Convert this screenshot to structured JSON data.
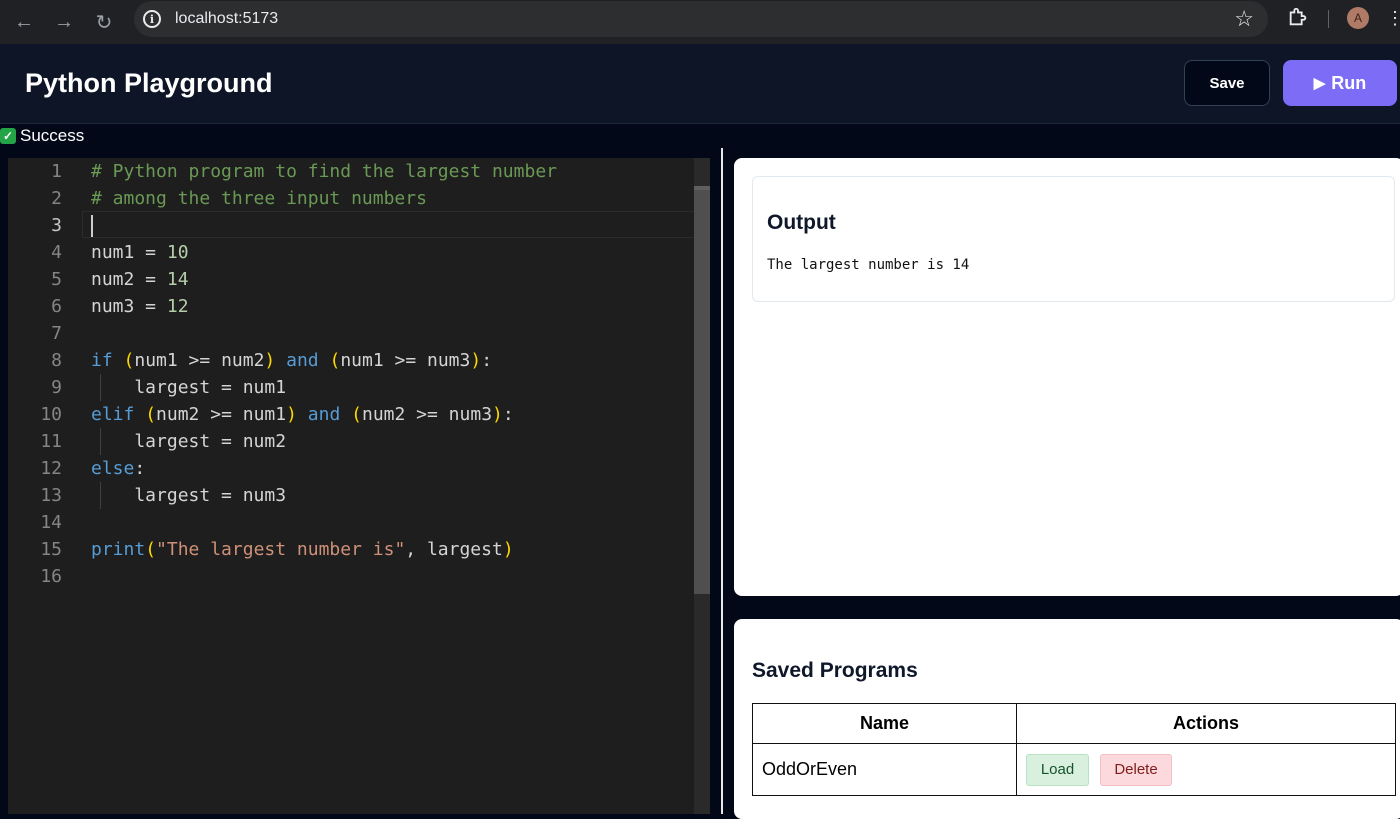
{
  "browser": {
    "url": "localhost:5173",
    "profile_initial": "A",
    "icons": [
      "back-arrow-icon",
      "forward-arrow-icon",
      "reload-icon",
      "site-info-icon",
      "bookmark-star-icon",
      "extensions-puzzle-icon",
      "more-menu-icon"
    ]
  },
  "header": {
    "title": "Python Playground",
    "save_label": "Save",
    "run_label": "Run"
  },
  "status": {
    "text": "Success",
    "color": "#22a447"
  },
  "editor": {
    "active_line": 3,
    "lines": [
      [
        {
          "t": "# Python program to find the largest number",
          "c": "c"
        }
      ],
      [
        {
          "t": "# among the three input numbers",
          "c": "c"
        }
      ],
      [],
      [
        {
          "t": "num1 = ",
          "c": ""
        },
        {
          "t": "10",
          "c": "n"
        }
      ],
      [
        {
          "t": "num2 = ",
          "c": ""
        },
        {
          "t": "14",
          "c": "n"
        }
      ],
      [
        {
          "t": "num3 = ",
          "c": ""
        },
        {
          "t": "12",
          "c": "n"
        }
      ],
      [],
      [
        {
          "t": "if",
          "c": "k"
        },
        {
          "t": " ",
          "c": ""
        },
        {
          "t": "(",
          "c": "p1"
        },
        {
          "t": "num1 >= num2",
          "c": ""
        },
        {
          "t": ")",
          "c": "p1"
        },
        {
          "t": " ",
          "c": ""
        },
        {
          "t": "and",
          "c": "k"
        },
        {
          "t": " ",
          "c": ""
        },
        {
          "t": "(",
          "c": "p1"
        },
        {
          "t": "num1 >= num3",
          "c": ""
        },
        {
          "t": ")",
          "c": "p1"
        },
        {
          "t": ":",
          "c": ""
        }
      ],
      [
        {
          "t": "    largest = num1",
          "c": ""
        }
      ],
      [
        {
          "t": "elif",
          "c": "k"
        },
        {
          "t": " ",
          "c": ""
        },
        {
          "t": "(",
          "c": "p1"
        },
        {
          "t": "num2 >= num1",
          "c": ""
        },
        {
          "t": ")",
          "c": "p1"
        },
        {
          "t": " ",
          "c": ""
        },
        {
          "t": "and",
          "c": "k"
        },
        {
          "t": " ",
          "c": ""
        },
        {
          "t": "(",
          "c": "p1"
        },
        {
          "t": "num2 >= num3",
          "c": ""
        },
        {
          "t": ")",
          "c": "p1"
        },
        {
          "t": ":",
          "c": ""
        }
      ],
      [
        {
          "t": "    largest = num2",
          "c": ""
        }
      ],
      [
        {
          "t": "else",
          "c": "k"
        },
        {
          "t": ":",
          "c": ""
        }
      ],
      [
        {
          "t": "    largest = num3",
          "c": ""
        }
      ],
      [],
      [
        {
          "t": "print",
          "c": "k"
        },
        {
          "t": "(",
          "c": "p1"
        },
        {
          "t": "\"The largest number is\"",
          "c": "s"
        },
        {
          "t": ", largest",
          "c": ""
        },
        {
          "t": ")",
          "c": "p1"
        }
      ],
      []
    ]
  },
  "output": {
    "title": "Output",
    "text": "The largest number is 14"
  },
  "saved": {
    "title": "Saved Programs",
    "columns": [
      "Name",
      "Actions"
    ],
    "rows": [
      {
        "name": "OddOrEven",
        "load_label": "Load",
        "delete_label": "Delete"
      }
    ]
  }
}
